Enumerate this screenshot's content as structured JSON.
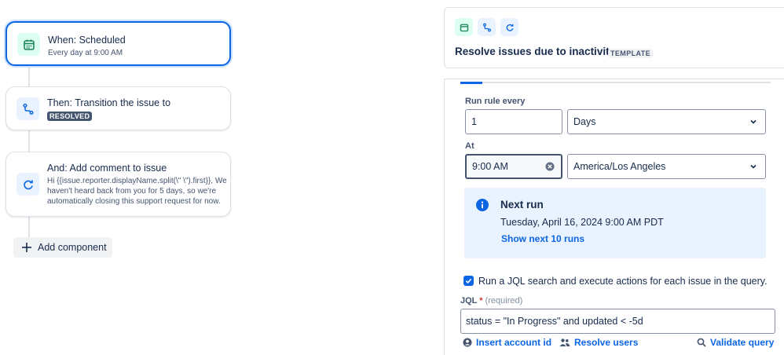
{
  "flow": {
    "trigger": {
      "title": "When: Scheduled",
      "subtitle": "Every day at 9:00 AM"
    },
    "action1": {
      "title": "Then: Transition the issue to",
      "status": "RESOLVED"
    },
    "action2": {
      "title": "And: Add comment to issue",
      "body_line1": "Hi {{issue.reporter.displayName.split(\\\" \\\").first}}, We",
      "body_line2": "haven't heard back from you for 5 days, so we're",
      "body_line3": "automatically closing this support request for now."
    },
    "add_component_label": "Add component"
  },
  "panel": {
    "title": "Resolve issues due to inactivity",
    "template_badge": "TEMPLATE",
    "run_every_label": "Run rule every",
    "run_every_value": "1",
    "run_every_unit": "Days",
    "at_label": "At",
    "at_value": "9:00 AM",
    "timezone": "America/Los Angeles",
    "next_run": {
      "title": "Next run",
      "date": "Tuesday, April 16, 2024 9:00 AM PDT",
      "link": "Show next 10 runs"
    },
    "jql_checkbox": {
      "checked": true,
      "label": "Run a JQL search and execute actions for each issue in the query."
    },
    "jql_label": "JQL",
    "jql_required_mark": "*",
    "jql_required_text": "(required)",
    "jql_value": "status = \"In Progress\" and updated < -5d",
    "links": {
      "insert_account": "Insert account id",
      "resolve_users": "Resolve users",
      "validate_query": "Validate query"
    }
  },
  "colors": {
    "accent": "#0c66e4",
    "trigger_icon_bg": "#dcfff1",
    "action_icon_bg": "#e9f2ff",
    "info_bg": "#e9f2ff"
  },
  "icons": [
    "calendar-icon",
    "branch-icon",
    "refresh-icon",
    "plus-icon",
    "chevron-down-icon",
    "clear-icon",
    "info-icon",
    "checkmark-icon",
    "user-circle-icon",
    "people-icon",
    "search-icon"
  ]
}
